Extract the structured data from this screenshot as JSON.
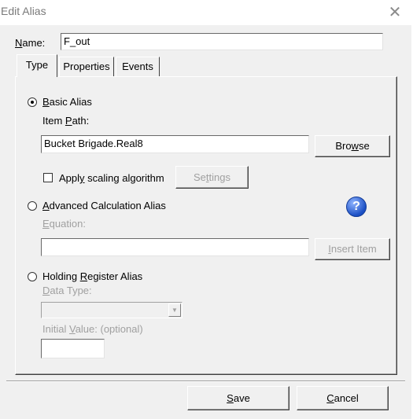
{
  "window": {
    "title": "Edit Alias",
    "close_glyph": "✕"
  },
  "name_field": {
    "label_prefix": "",
    "label_accel": "N",
    "label_rest": "ame:",
    "value": "F_out"
  },
  "tabs": [
    {
      "label": "Type",
      "active": true
    },
    {
      "label": "Properties",
      "active": false
    },
    {
      "label": "Events",
      "active": false
    }
  ],
  "basic_alias": {
    "radio_accel": "B",
    "radio_rest": "asic Alias",
    "selected": true,
    "item_path_prefix": "Item ",
    "item_path_accel": "P",
    "item_path_rest": "ath:",
    "item_path_value": "Bucket Brigade.Real8",
    "browse_prefix": "Bro",
    "browse_accel": "w",
    "browse_rest": "se",
    "scaling_prefix": "Appl",
    "scaling_accel": "y",
    "scaling_rest": " scaling algorithm",
    "scaling_checked": false,
    "settings_prefix": "Se",
    "settings_accel": "t",
    "settings_rest": "tings"
  },
  "advanced_alias": {
    "radio_accel": "A",
    "radio_rest": "dvanced Calculation Alias",
    "selected": false,
    "equation_accel": "E",
    "equation_rest": "quation:",
    "equation_value": "",
    "insert_accel": "I",
    "insert_rest": "nsert Item",
    "help_glyph": "?"
  },
  "holding_alias": {
    "radio_prefix": "Holding ",
    "radio_accel": "R",
    "radio_rest": "egister Alias",
    "selected": false,
    "data_type_accel": "D",
    "data_type_rest": "ata Type:",
    "data_type_value": "",
    "combo_arrow": "▼",
    "init_prefix": "Initial ",
    "init_accel": "V",
    "init_rest": "alue: (optional)",
    "init_value": ""
  },
  "footer": {
    "save_accel": "S",
    "save_rest": "ave",
    "cancel_accel": "C",
    "cancel_rest": "ancel"
  }
}
